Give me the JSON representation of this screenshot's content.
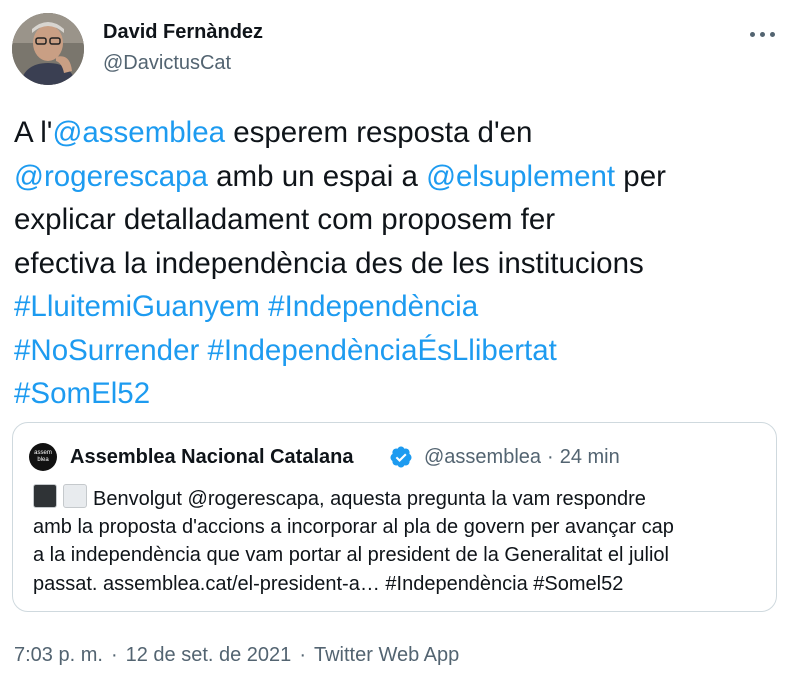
{
  "author": {
    "name": "David Fernàndez",
    "handle": "@DavictusCat"
  },
  "menu": {
    "icon": "more-horizontal-icon"
  },
  "tweet": {
    "lines": [
      [
        {
          "t": "A l'"
        },
        {
          "t": "@assemblea",
          "link": true
        },
        {
          "t": " esperem resposta d'en"
        }
      ],
      [
        {
          "t": "@rogerescapa",
          "link": true
        },
        {
          "t": " amb un espai a "
        },
        {
          "t": "@elsuplement",
          "link": true
        },
        {
          "t": " per"
        }
      ],
      [
        {
          "t": "explicar detalladament com proposem fer"
        }
      ],
      [
        {
          "t": "efectiva la independència des de les institucions"
        }
      ],
      [
        {
          "t": "#LluitemiGuanyem",
          "link": true
        },
        {
          "t": " "
        },
        {
          "t": "#Independència",
          "link": true
        }
      ],
      [
        {
          "t": "#NoSurrender",
          "link": true
        },
        {
          "t": " "
        },
        {
          "t": "#IndependènciaÉsLlibertat",
          "link": true
        }
      ],
      [
        {
          "t": "#SomEl52",
          "link": true
        }
      ]
    ]
  },
  "quote": {
    "avatar_text": "assem blea",
    "name": "Assemblea Nacional Catalana",
    "verified_icon": "verified-badge-icon",
    "handle": "@assemblea",
    "separator": "·",
    "time": "24 min",
    "lines": [
      "Benvolgut @rogerescapa, aquesta pregunta la vam respondre",
      "amb la proposta d'accions a incorporar al pla de govern per avançar cap",
      "a la independència que vam portar al president de la Generalitat el juliol",
      "passat. assemblea.cat/el-president-a… #Independència #Somel52"
    ]
  },
  "footer": {
    "time": "7:03 p. m.",
    "separator": "·",
    "date": "12 de set. de 2021",
    "app": "Twitter Web App"
  },
  "colors": {
    "link": "#1d9bf0",
    "text": "#0f1419",
    "secondary": "#536471",
    "border": "#cfd9de"
  }
}
